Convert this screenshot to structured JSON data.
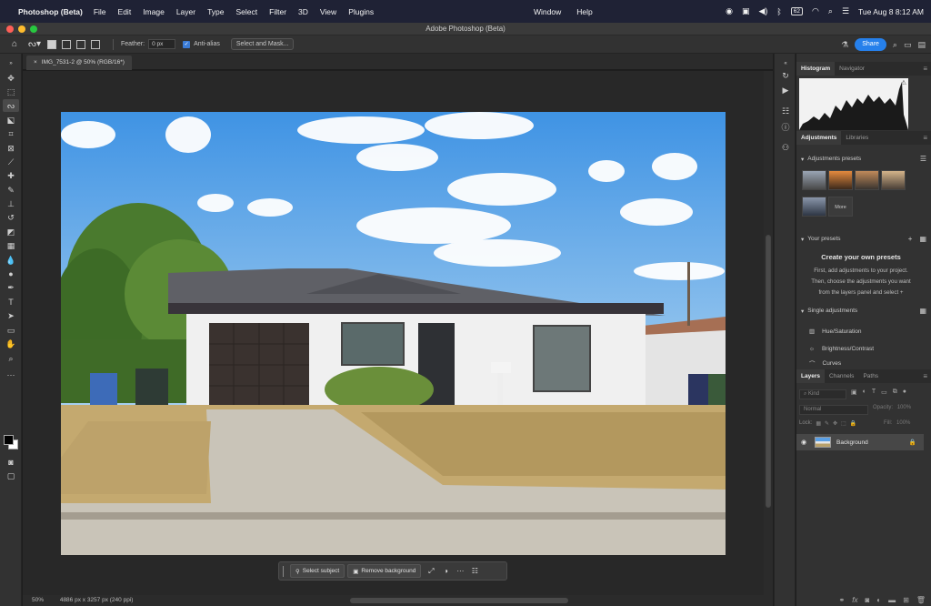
{
  "menubar": {
    "app_name": "Photoshop (Beta)",
    "menus": [
      "File",
      "Edit",
      "Image",
      "Layer",
      "Type",
      "Select",
      "Filter",
      "3D",
      "View",
      "Plugins"
    ],
    "menus_right": [
      "Window",
      "Help"
    ],
    "datetime": "Tue Aug 8  8:12 AM",
    "battery": "62"
  },
  "window": {
    "title": "Adobe Photoshop (Beta)"
  },
  "options": {
    "feather_label": "Feather:",
    "feather_value": "0 px",
    "anti_alias_label": "Anti-alias",
    "select_mask_label": "Select and Mask...",
    "share_label": "Share"
  },
  "document": {
    "tab_label": "IMG_7531-2 @ 50% (RGB/16*)",
    "zoom": "50%",
    "dimensions": "4886 px x 3257 px (240 ppi)"
  },
  "taskbar": {
    "select_subject": "Select subject",
    "remove_background": "Remove background"
  },
  "panels": {
    "histogram_tab": "Histogram",
    "navigator_tab": "Navigator",
    "adjustments_tab": "Adjustments",
    "libraries_tab": "Libraries",
    "adjustment_presets_label": "Adjustments presets",
    "more_label": "More",
    "your_presets_label": "Your presets",
    "create_presets_title": "Create your own presets",
    "create_presets_line1": "First, add adjustments to your project.",
    "create_presets_line2": "Then, choose the adjustments you want",
    "create_presets_line3": "from the layers panel and select",
    "single_adjustments_label": "Single adjustments",
    "adjustments": [
      "Hue/Saturation",
      "Brightness/Contrast",
      "Curves"
    ],
    "layers_tab": "Layers",
    "channels_tab": "Channels",
    "paths_tab": "Paths",
    "kind_placeholder": "Kind",
    "blend_mode": "Normal",
    "opacity_label": "Opacity:",
    "opacity_value": "100%",
    "lock_label": "Lock:",
    "fill_label": "Fill:",
    "fill_value": "100%",
    "layer_name": "Background"
  }
}
